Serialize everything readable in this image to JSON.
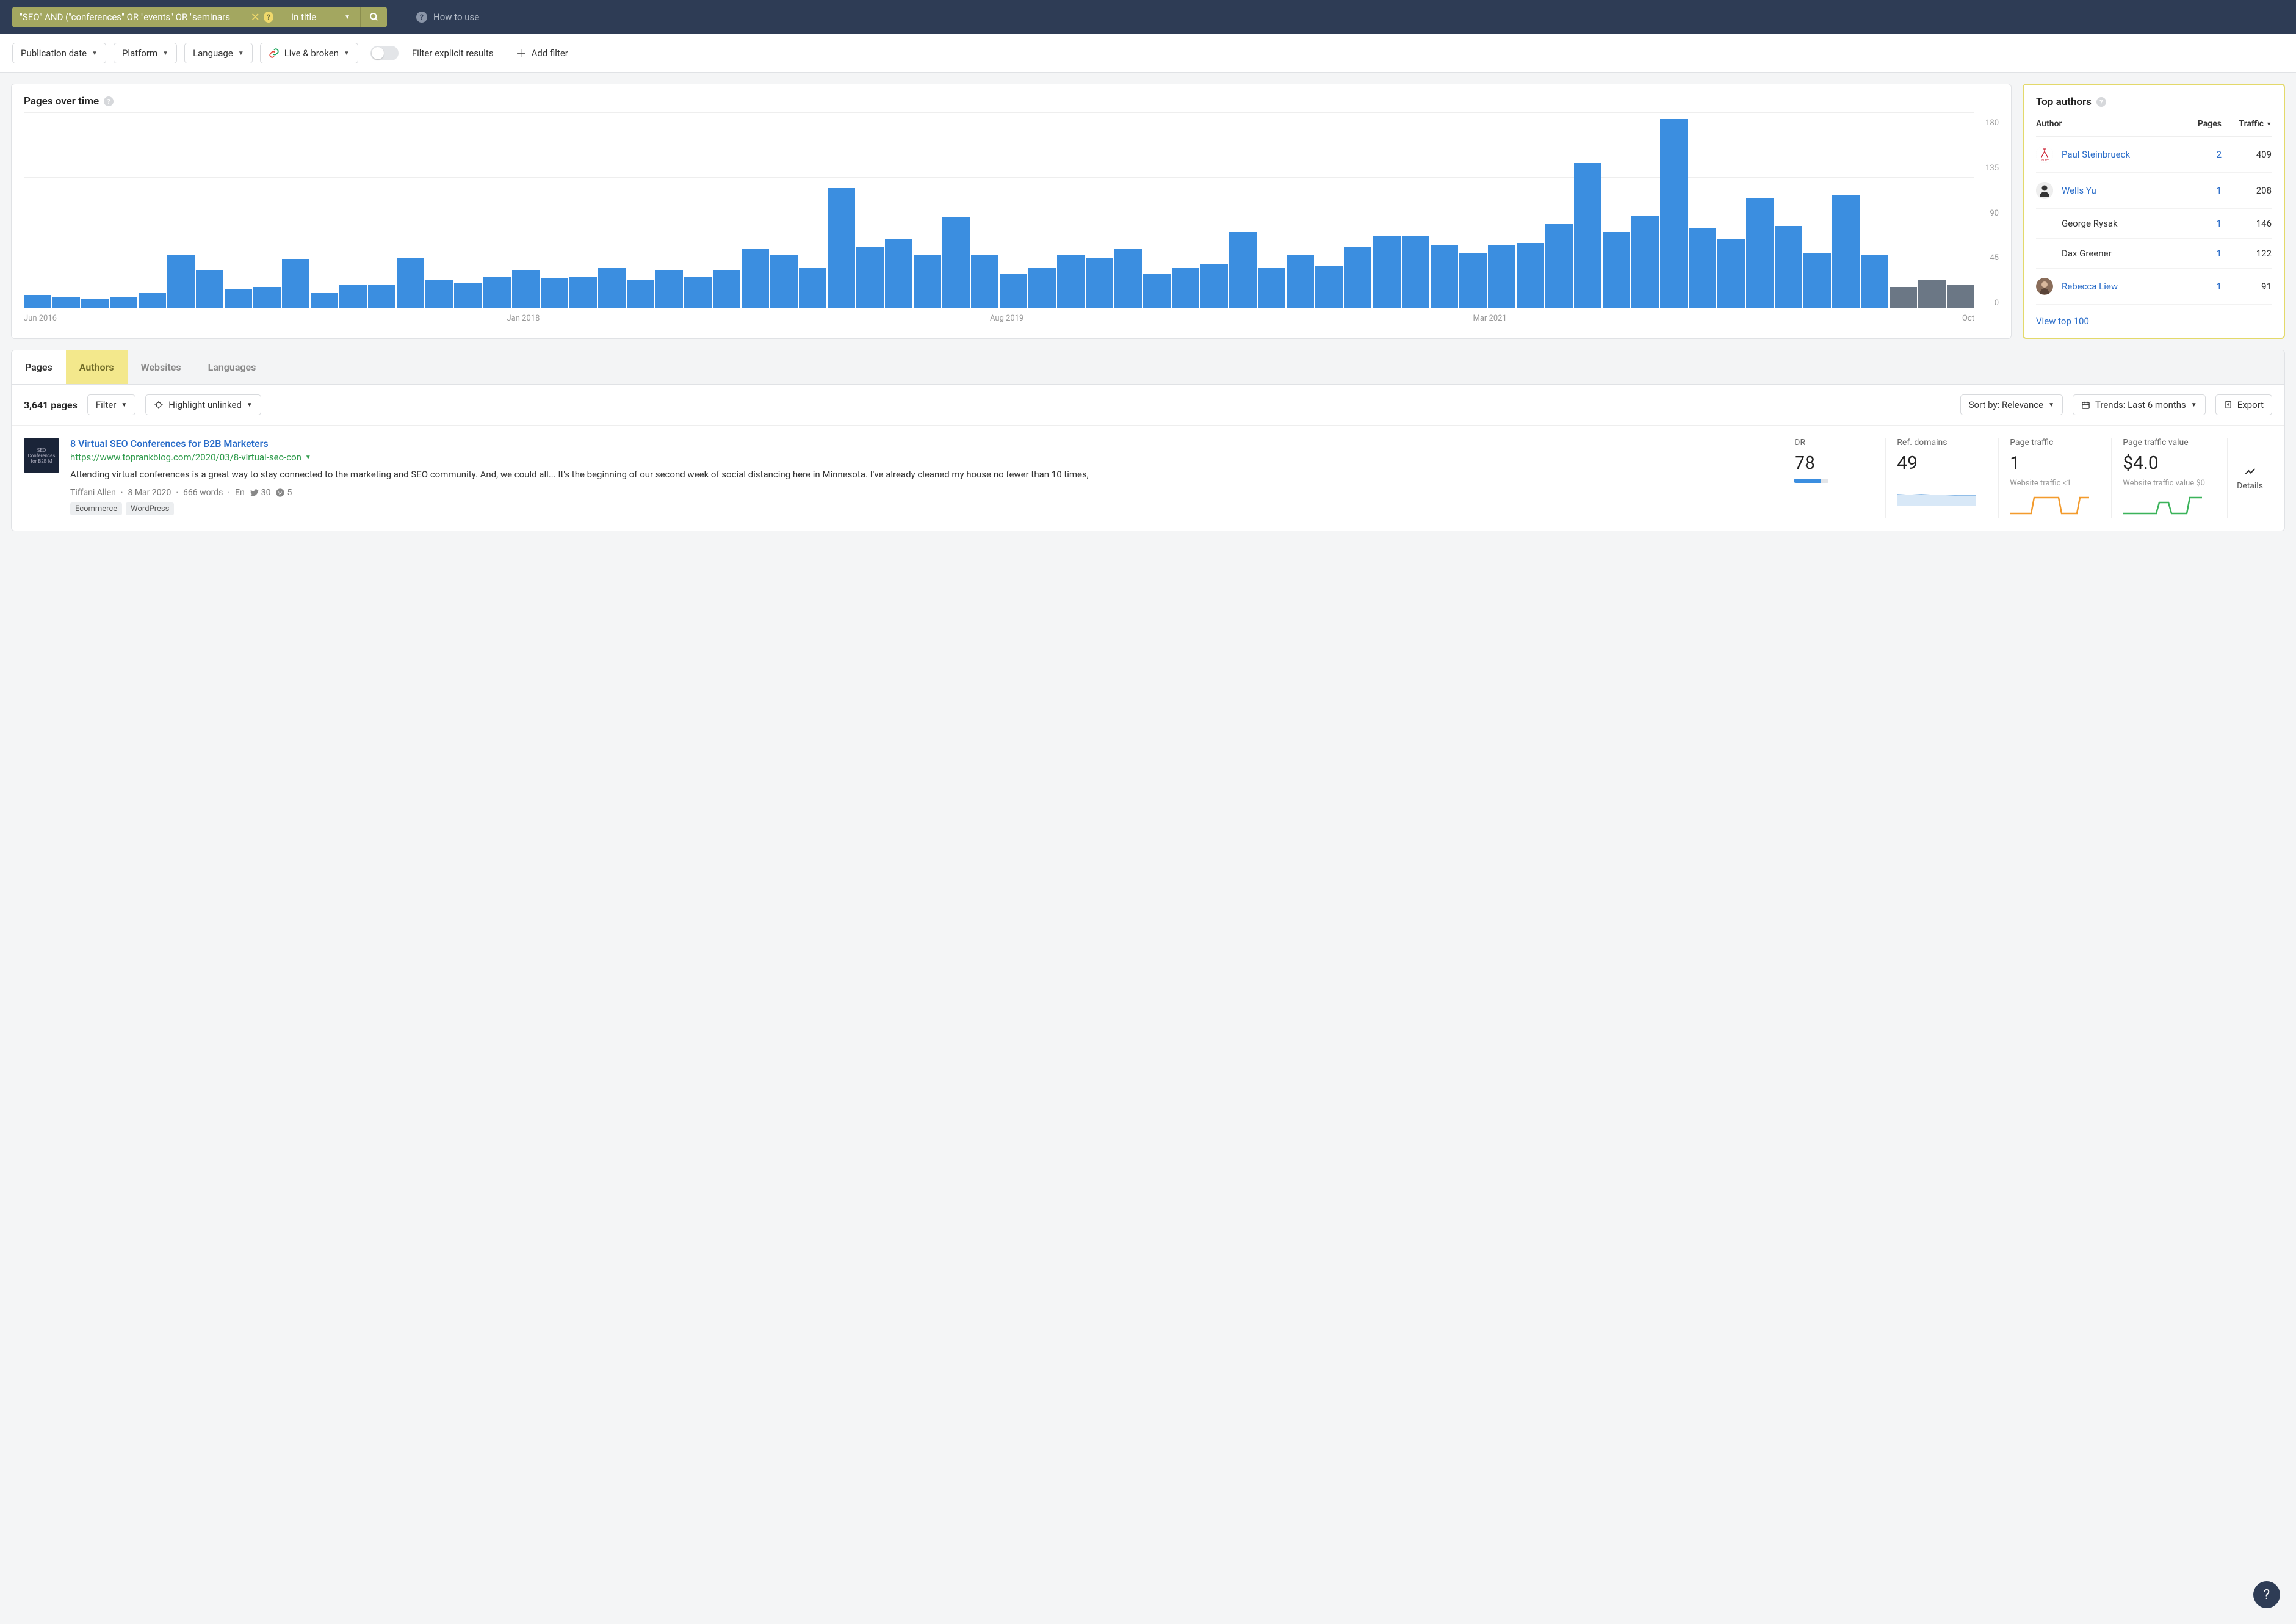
{
  "search": {
    "query": "\"SEO\" AND (\"conferences\" OR \"events\" OR \"seminars",
    "scope": "In title"
  },
  "howto": "How to use",
  "filters": {
    "pub_date": "Publication date",
    "platform": "Platform",
    "language": "Language",
    "live_broken": "Live & broken",
    "explicit": "Filter explicit results",
    "add": "Add filter"
  },
  "chart": {
    "title": "Pages over time",
    "xlabels": [
      "Jun 2016",
      "Jan 2018",
      "Aug 2019",
      "Mar 2021",
      "Oct"
    ],
    "ylabels": [
      "180",
      "135",
      "90",
      "45",
      "0"
    ]
  },
  "chart_data": {
    "type": "bar",
    "title": "Pages over time",
    "ylabel": "Pages",
    "ylim": [
      0,
      180
    ],
    "x_range": [
      "Jun 2016",
      "Oct 2022"
    ],
    "values": [
      12,
      10,
      8,
      10,
      14,
      50,
      36,
      18,
      20,
      46,
      14,
      22,
      22,
      48,
      26,
      24,
      30,
      36,
      28,
      30,
      38,
      26,
      36,
      30,
      36,
      56,
      50,
      38,
      114,
      58,
      66,
      50,
      86,
      50,
      32,
      38,
      50,
      48,
      56,
      32,
      38,
      42,
      72,
      38,
      50,
      40,
      58,
      68,
      68,
      60,
      52,
      60,
      62,
      80,
      138,
      72,
      88,
      190,
      76,
      66,
      104,
      78,
      52,
      108,
      50,
      20,
      26,
      22
    ]
  },
  "authors": {
    "title": "Top authors",
    "head_author": "Author",
    "head_pages": "Pages",
    "head_traffic": "Traffic",
    "rows": [
      {
        "name": "Paul Steinbrueck",
        "pages": "2",
        "traffic": "409",
        "link": true
      },
      {
        "name": "Wells Yu",
        "pages": "1",
        "traffic": "208",
        "link": true
      },
      {
        "name": "George Rysak",
        "pages": "1",
        "traffic": "146",
        "link": false
      },
      {
        "name": "Dax Greener",
        "pages": "1",
        "traffic": "122",
        "link": false
      },
      {
        "name": "Rebecca Liew",
        "pages": "1",
        "traffic": "91",
        "link": true
      }
    ],
    "view_all": "View top 100"
  },
  "tabs": {
    "pages": "Pages",
    "authors": "Authors",
    "websites": "Websites",
    "languages": "Languages"
  },
  "results_bar": {
    "count": "3,641 pages",
    "filter": "Filter",
    "highlight": "Highlight unlinked",
    "sort": "Sort by: Relevance",
    "trends": "Trends: Last 6 months",
    "export": "Export"
  },
  "result": {
    "title": "8 Virtual SEO Conferences for B2B Marketers",
    "url": "https://www.toprankblog.com/2020/03/8-virtual-seo-con",
    "desc": "Attending virtual conferences is a great way to stay connected to the marketing and SEO community. And, we could all... It's the beginning of our second week of social distancing here in Minnesota. I've already cleaned my house no fewer than 10 times,",
    "author": "Tiffani Allen",
    "date": "8 Mar 2020",
    "words": "666 words",
    "lang": "En",
    "tw": "30",
    "pin": "5",
    "tags": [
      "Ecommerce",
      "WordPress"
    ],
    "metrics": {
      "dr_label": "DR",
      "dr": "78",
      "ref_label": "Ref. domains",
      "ref": "49",
      "pt_label": "Page traffic",
      "pt": "1",
      "pt_sub": "Website traffic <1",
      "ptv_label": "Page traffic value",
      "ptv": "$4.0",
      "ptv_sub": "Website traffic value $0"
    },
    "details": "Details"
  }
}
